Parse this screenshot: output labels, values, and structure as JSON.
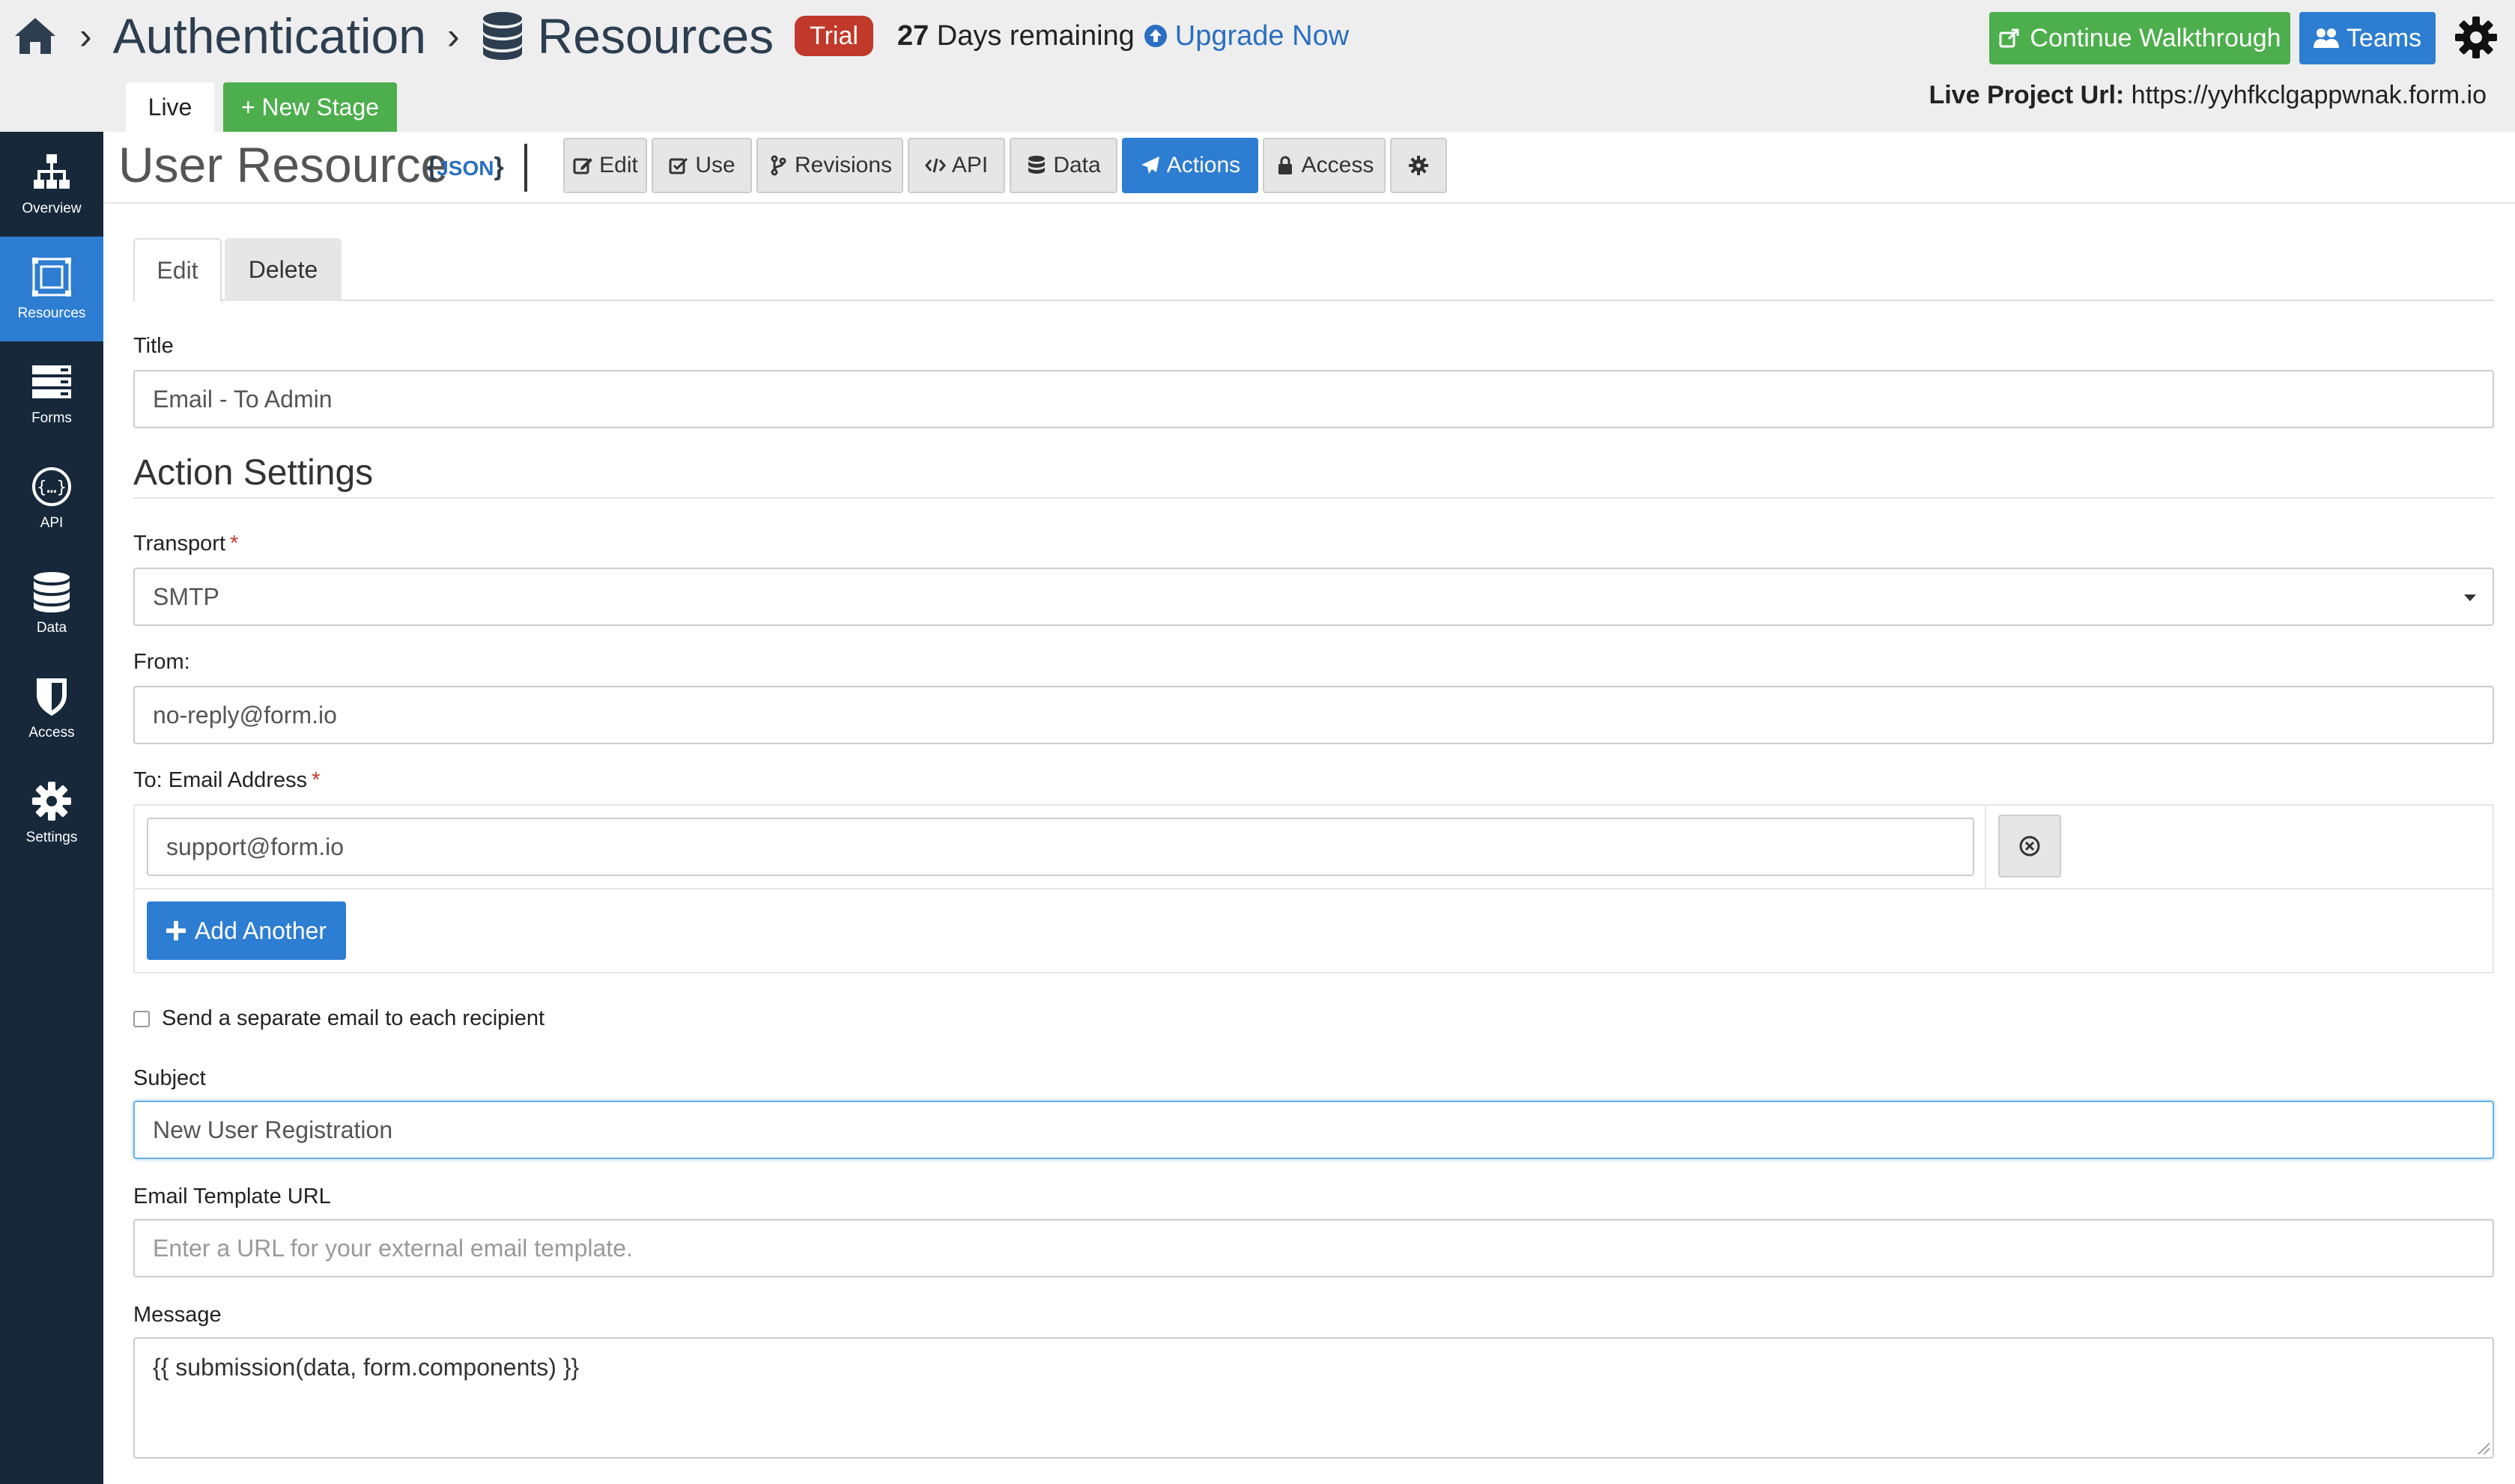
{
  "header": {
    "crumb_1": "Authentication",
    "crumb_2": "Resources",
    "trial_badge": "Trial",
    "days_remaining_count": "27",
    "days_remaining_text": " Days remaining",
    "upgrade_label": "Upgrade Now",
    "walkthrough_label": "Continue Walkthrough",
    "teams_label": "Teams",
    "live_url_label": "Live Project Url:",
    "live_url_value": "https://yyhfkclgappwnak.form.io",
    "stage_live": "Live",
    "stage_new": "+ New Stage"
  },
  "sidebar": {
    "items": [
      {
        "label": "Overview",
        "icon": "sitemap-icon"
      },
      {
        "label": "Resources",
        "icon": "resources-icon",
        "active": true
      },
      {
        "label": "Forms",
        "icon": "forms-icon"
      },
      {
        "label": "API",
        "icon": "api-icon"
      },
      {
        "label": "Data",
        "icon": "database-icon"
      },
      {
        "label": "Access",
        "icon": "shield-icon"
      },
      {
        "label": "Settings",
        "icon": "gear-icon"
      }
    ]
  },
  "resource": {
    "title": "User Resource",
    "json_label": "JSON",
    "tabs": [
      {
        "label": "Edit",
        "icon": "edit-icon"
      },
      {
        "label": "Use",
        "icon": "check-square-icon"
      },
      {
        "label": "Revisions",
        "icon": "branch-icon"
      },
      {
        "label": "API",
        "icon": "code-icon"
      },
      {
        "label": "Data",
        "icon": "database-icon"
      },
      {
        "label": "Actions",
        "icon": "paper-plane-icon",
        "active": true
      },
      {
        "label": "Access",
        "icon": "lock-icon"
      },
      {
        "label": "",
        "icon": "gear-icon"
      }
    ]
  },
  "subtabs": {
    "edit": "Edit",
    "delete": "Delete"
  },
  "form": {
    "title_label": "Title",
    "title_value": "Email - To Admin",
    "section_title": "Action Settings",
    "transport_label": "Transport",
    "transport_value": "SMTP",
    "from_label": "From:",
    "from_value": "no-reply@form.io",
    "to_label": "To: Email Address",
    "to_value": "support@form.io",
    "add_another": "Add Another",
    "separate_email_label": "Send a separate email to each recipient",
    "separate_email_checked": false,
    "subject_label": "Subject",
    "subject_value": "New User Registration",
    "template_url_label": "Email Template URL",
    "template_url_placeholder": "Enter a URL for your external email template.",
    "message_label": "Message",
    "message_value": "{{ submission(data, form.components) }}",
    "required_marker": "*"
  },
  "colors": {
    "sidebar_bg": "#16283a",
    "primary": "#2d7dd2",
    "success": "#4cae4c",
    "danger": "#c0392b"
  }
}
